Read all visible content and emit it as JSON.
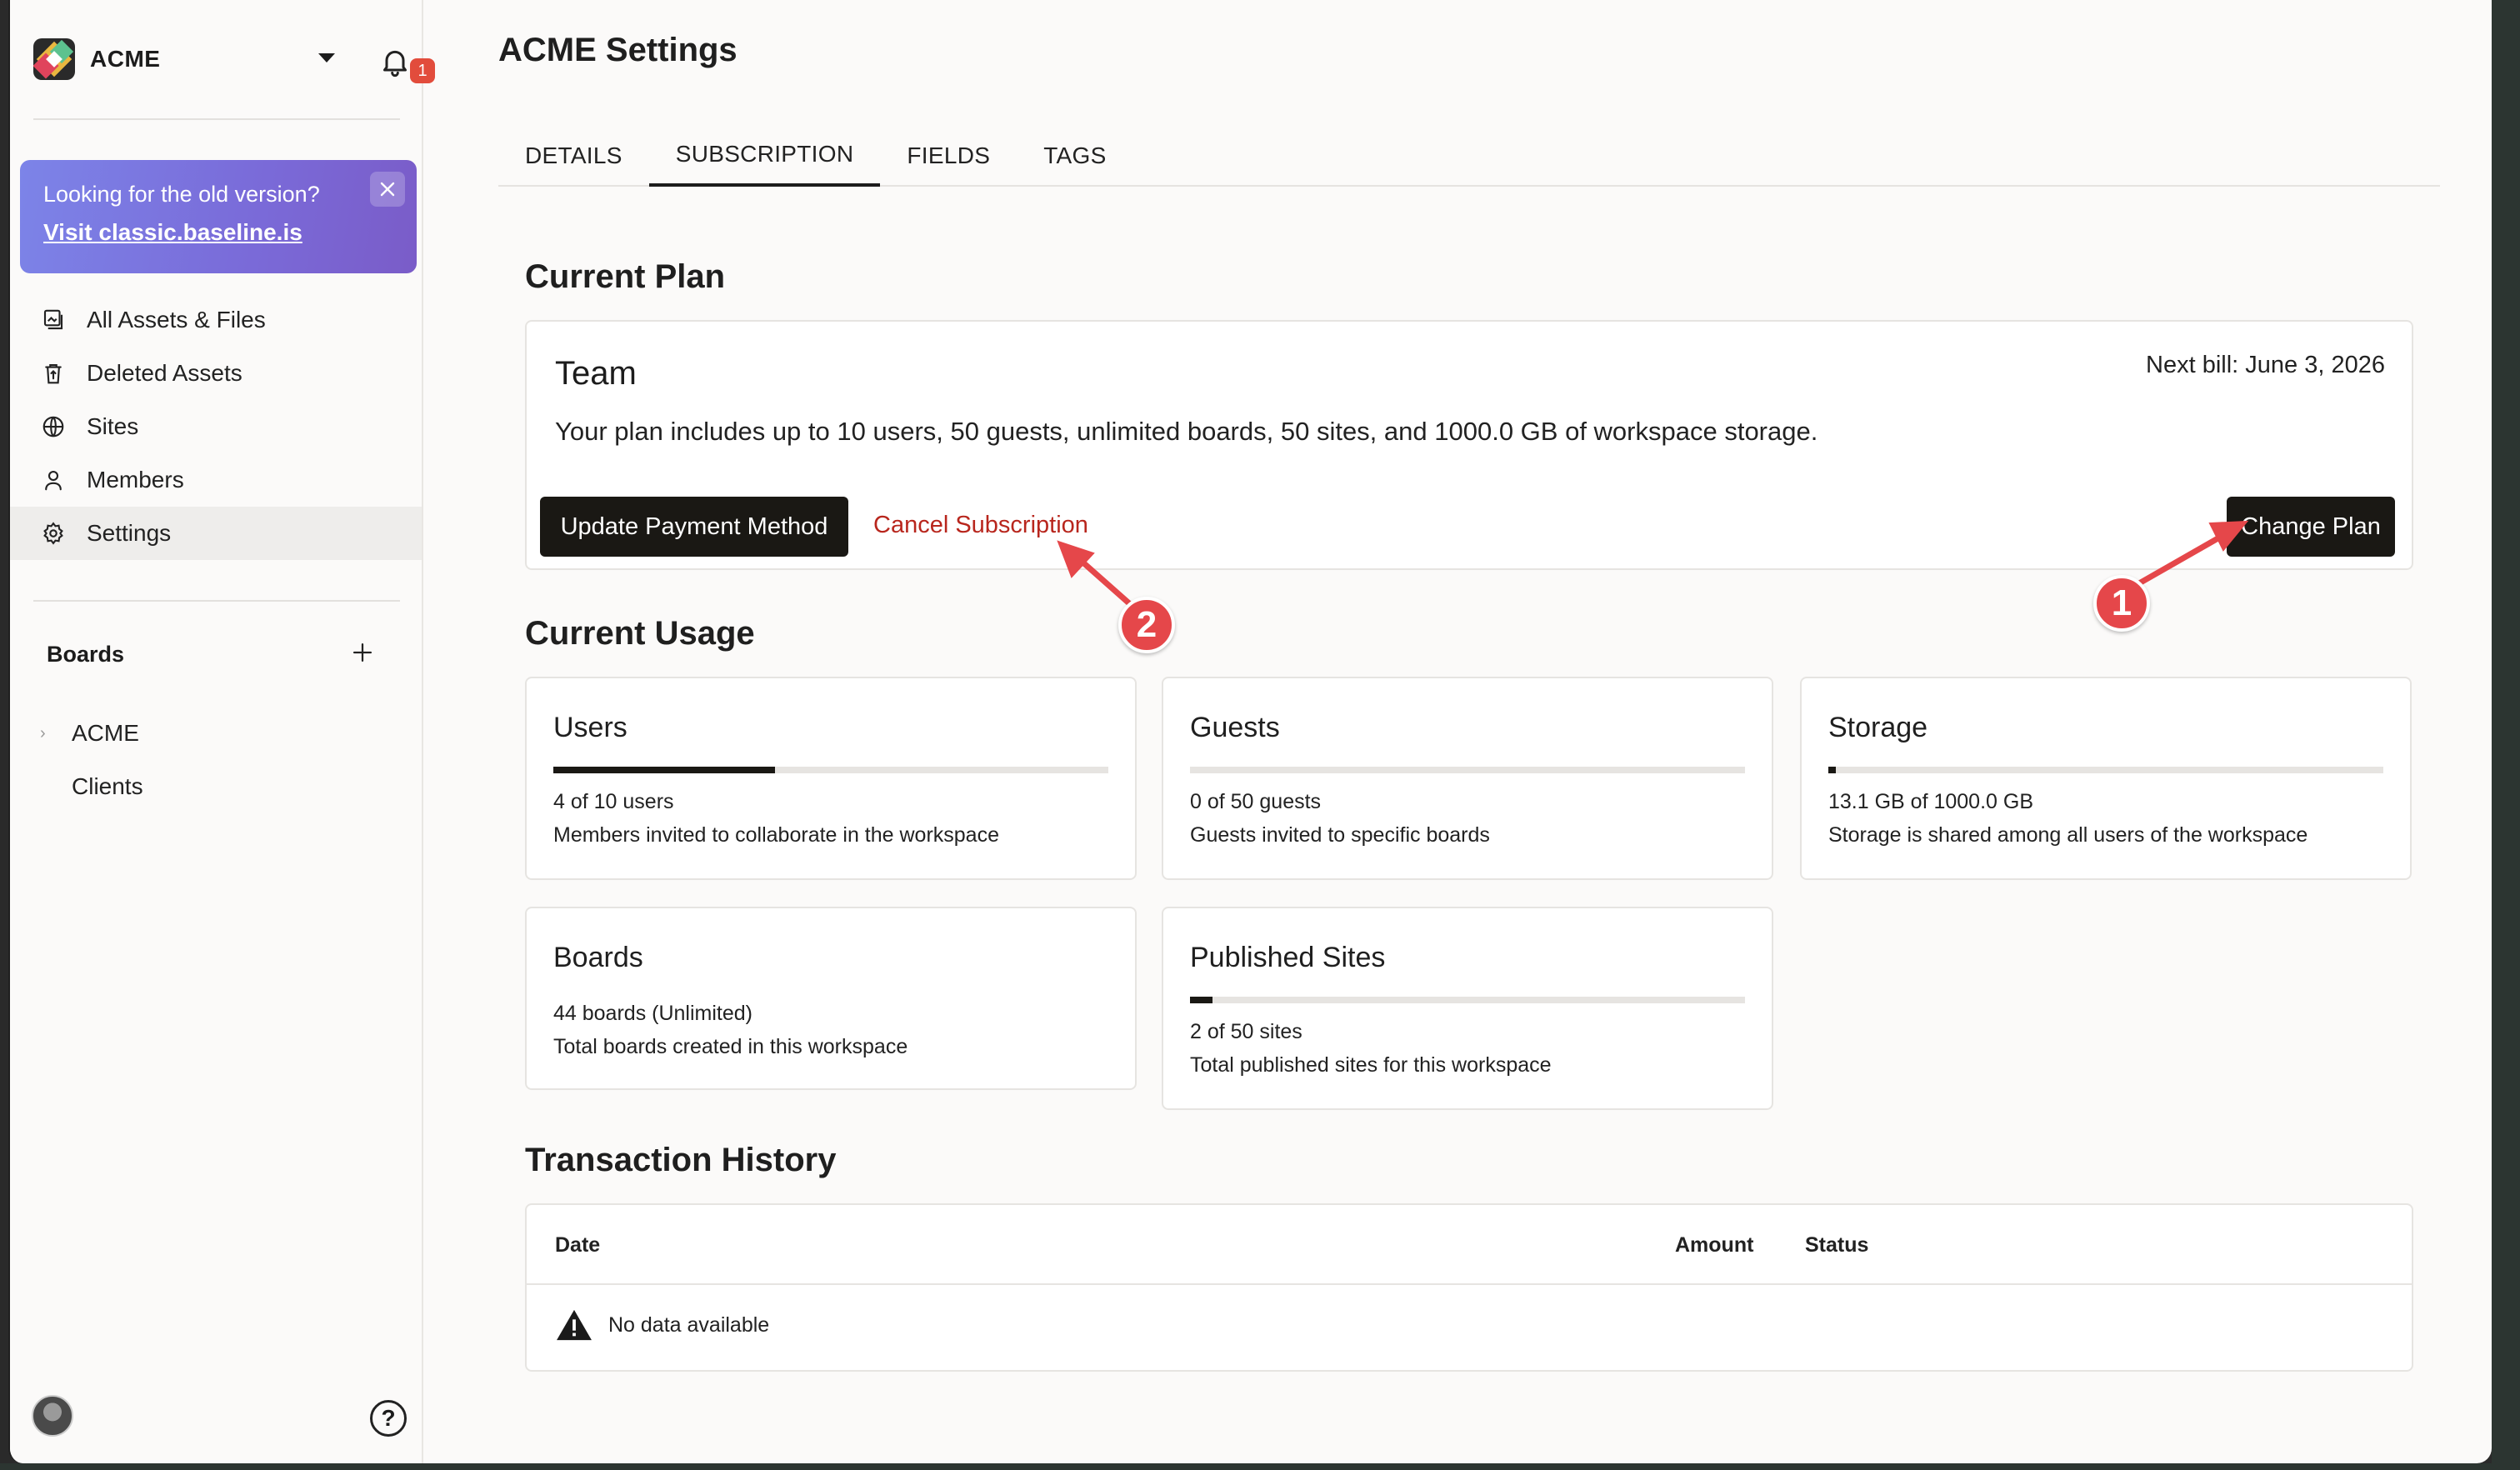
{
  "workspace": {
    "name": "ACME",
    "notification_count": "1"
  },
  "promo": {
    "text": "Looking for the old version?",
    "link": "Visit classic.baseline.is"
  },
  "nav": {
    "items": [
      {
        "label": "All Assets & Files",
        "icon": "assets-icon"
      },
      {
        "label": "Deleted Assets",
        "icon": "trash-icon"
      },
      {
        "label": "Sites",
        "icon": "globe-icon"
      },
      {
        "label": "Members",
        "icon": "person-icon"
      },
      {
        "label": "Settings",
        "icon": "gear-icon",
        "active": true
      }
    ]
  },
  "boards": {
    "heading": "Boards",
    "items": [
      "ACME",
      "Clients"
    ]
  },
  "header": {
    "title": "ACME Settings"
  },
  "tabs": [
    {
      "label": "DETAILS"
    },
    {
      "label": "SUBSCRIPTION",
      "active": true
    },
    {
      "label": "FIELDS"
    },
    {
      "label": "TAGS"
    }
  ],
  "plan": {
    "heading": "Current Plan",
    "name": "Team",
    "next_bill": "Next bill: June 3, 2026",
    "description": "Your plan includes up to 10 users, 50 guests, unlimited boards, 50 sites, and 1000.0 GB of workspace storage.",
    "update_payment_label": "Update Payment Method",
    "cancel_label": "Cancel Subscription",
    "change_plan_label": "Change Plan"
  },
  "usage": {
    "heading": "Current Usage",
    "cards": [
      {
        "title": "Users",
        "progress": 0.4,
        "line1": "4 of 10 users",
        "line2": "Members invited to collaborate in the workspace"
      },
      {
        "title": "Guests",
        "progress": 0.0,
        "line1": "0 of 50 guests",
        "line2": "Guests invited to specific boards"
      },
      {
        "title": "Storage",
        "progress": 0.013,
        "line1": "13.1 GB of 1000.0 GB",
        "line2": "Storage is shared among all users of the workspace"
      },
      {
        "title": "Boards",
        "line1": "44 boards (Unlimited)",
        "line2": "Total boards created in this workspace"
      },
      {
        "title": "Published Sites",
        "progress": 0.04,
        "line1": "2 of 50 sites",
        "line2": "Total published sites for this workspace"
      }
    ]
  },
  "transactions": {
    "heading": "Transaction History",
    "columns": [
      "Date",
      "Amount",
      "Status"
    ],
    "empty_text": "No data available"
  },
  "annotations": {
    "step1": "1",
    "step2": "2",
    "color": "#e5474a"
  }
}
